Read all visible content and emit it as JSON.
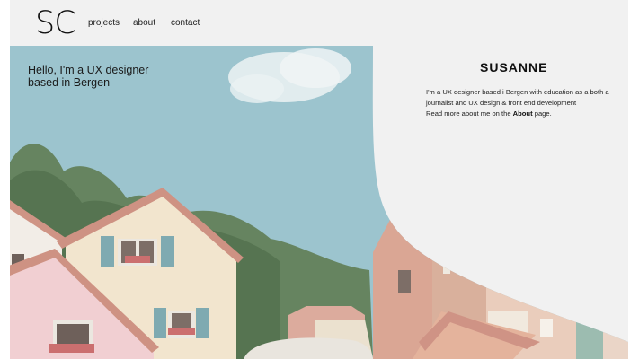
{
  "nav": {
    "logo": "SC",
    "links": [
      {
        "label": "projects"
      },
      {
        "label": "about"
      },
      {
        "label": "contact"
      }
    ]
  },
  "hero": {
    "greeting_line1": "Hello, I'm a UX designer",
    "greeting_line2": "based in Bergen"
  },
  "profile": {
    "name": "SUSANNE",
    "bio": "I'm a UX designer based i Bergen with education as a both a journalist and UX design & front end development",
    "more_prefix": "Read more about me on the ",
    "more_link": "About",
    "more_suffix": " page."
  },
  "colors": {
    "page_bg": "#f1f1f1",
    "sky": "#8fbcc8",
    "text": "#111111"
  }
}
